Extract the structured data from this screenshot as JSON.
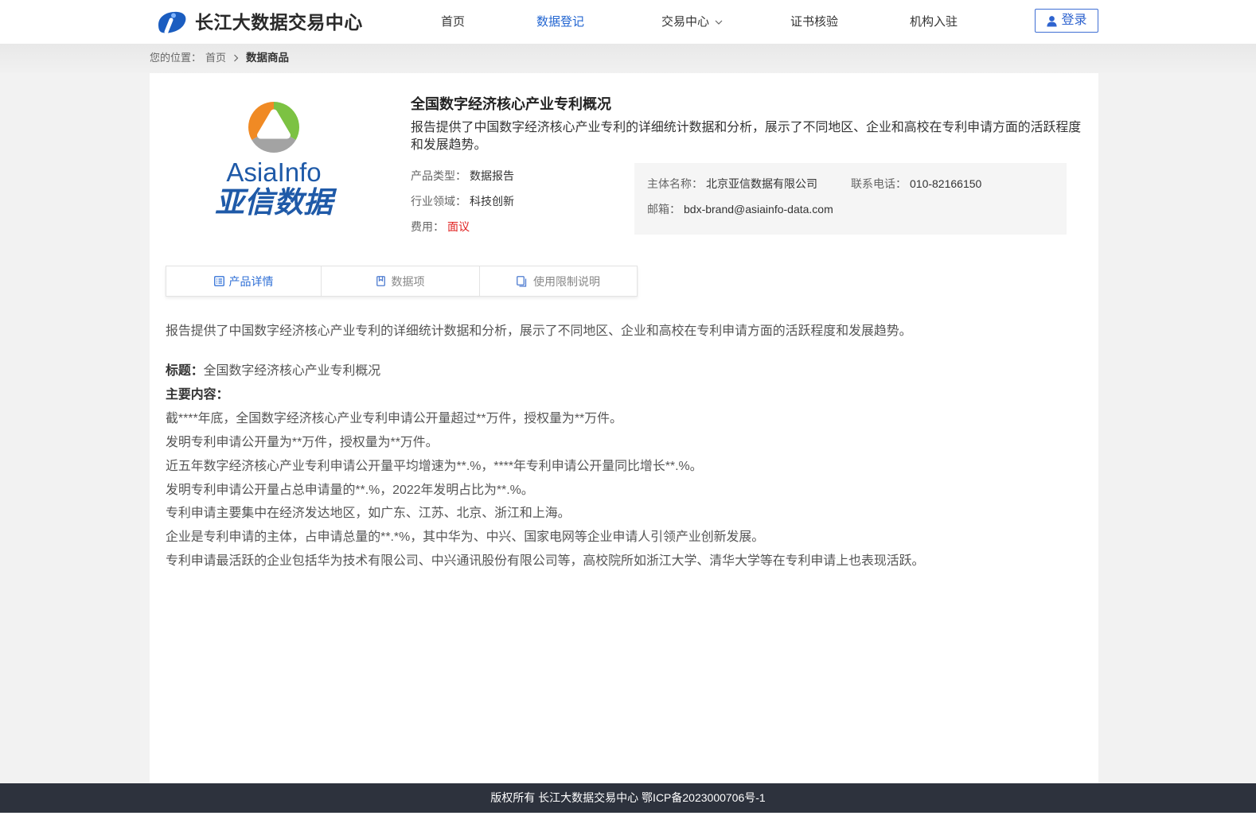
{
  "theme": {
    "accent": "#2366d1",
    "footer_bg": "#2d323d",
    "price": "#e0201f"
  },
  "header": {
    "brand": "长江大数据交易中心",
    "nav": [
      {
        "label": "首页"
      },
      {
        "label": "数据登记",
        "active": true
      },
      {
        "label": "交易中心",
        "has_dropdown": true
      },
      {
        "label": "证书核验"
      },
      {
        "label": "机构入驻"
      }
    ],
    "login_label": "登录"
  },
  "breadcrumb": {
    "prefix": "您的位置：",
    "items": [
      "首页",
      "数据商品"
    ]
  },
  "product": {
    "logo": {
      "wordmark": "AsiaInfo",
      "chinese_name": "亚信数据"
    },
    "title": "全国数字经济核心产业专利概况",
    "summary": "报告提供了中国数字经济核心产业专利的详细统计数据和分析，展示了不同地区、企业和高校在专利申请方面的活跃程度和发展趋势。",
    "fields": [
      {
        "label": "产品类型：",
        "value": "数据报告"
      },
      {
        "label": "行业领域：",
        "value": "科技创新"
      },
      {
        "label": "费用：",
        "value": "面议"
      }
    ],
    "provider": {
      "name_label": "主体名称：",
      "name": "北京亚信数据有限公司",
      "phone_label": "联系电话：",
      "phone": "010-82166150",
      "email_label": "邮箱：",
      "email": "bdx-brand@asiainfo-data.com"
    }
  },
  "tabs": [
    {
      "label": "产品详情",
      "icon": "list-doc-icon",
      "active": true
    },
    {
      "label": "数据项",
      "icon": "bookmark-doc-icon"
    },
    {
      "label": "使用限制说明",
      "icon": "copy-doc-icon"
    }
  ],
  "detail": {
    "intro": "报告提供了中国数字经济核心产业专利的详细统计数据和分析，展示了不同地区、企业和高校在专利申请方面的活跃程度和发展趋势。",
    "title_label": "标题：",
    "title_value": "全国数字经济核心产业专利概况",
    "main_label": "主要内容：",
    "lines": [
      "截****年底，全国数字经济核心产业专利申请公开量超过**万件，授权量为**万件。",
      "发明专利申请公开量为**万件，授权量为**万件。",
      "近五年数字经济核心产业专利申请公开量平均增速为**.%，****年专利申请公开量同比增长**.%。",
      "发明专利申请公开量占总申请量的**.%，2022年发明占比为**.%。",
      "专利申请主要集中在经济发达地区，如广东、江苏、北京、浙江和上海。",
      "企业是专利申请的主体，占申请总量的**.*%，其中华为、中兴、国家电网等企业申请人引领产业创新发展。",
      "专利申请最活跃的企业包括华为技术有限公司、中兴通讯股份有限公司等，高校院所如浙江大学、清华大学等在专利申请上也表现活跃。"
    ]
  },
  "footer": {
    "text": "版权所有 长江大数据交易中心 鄂ICP备2023000706号-1"
  }
}
